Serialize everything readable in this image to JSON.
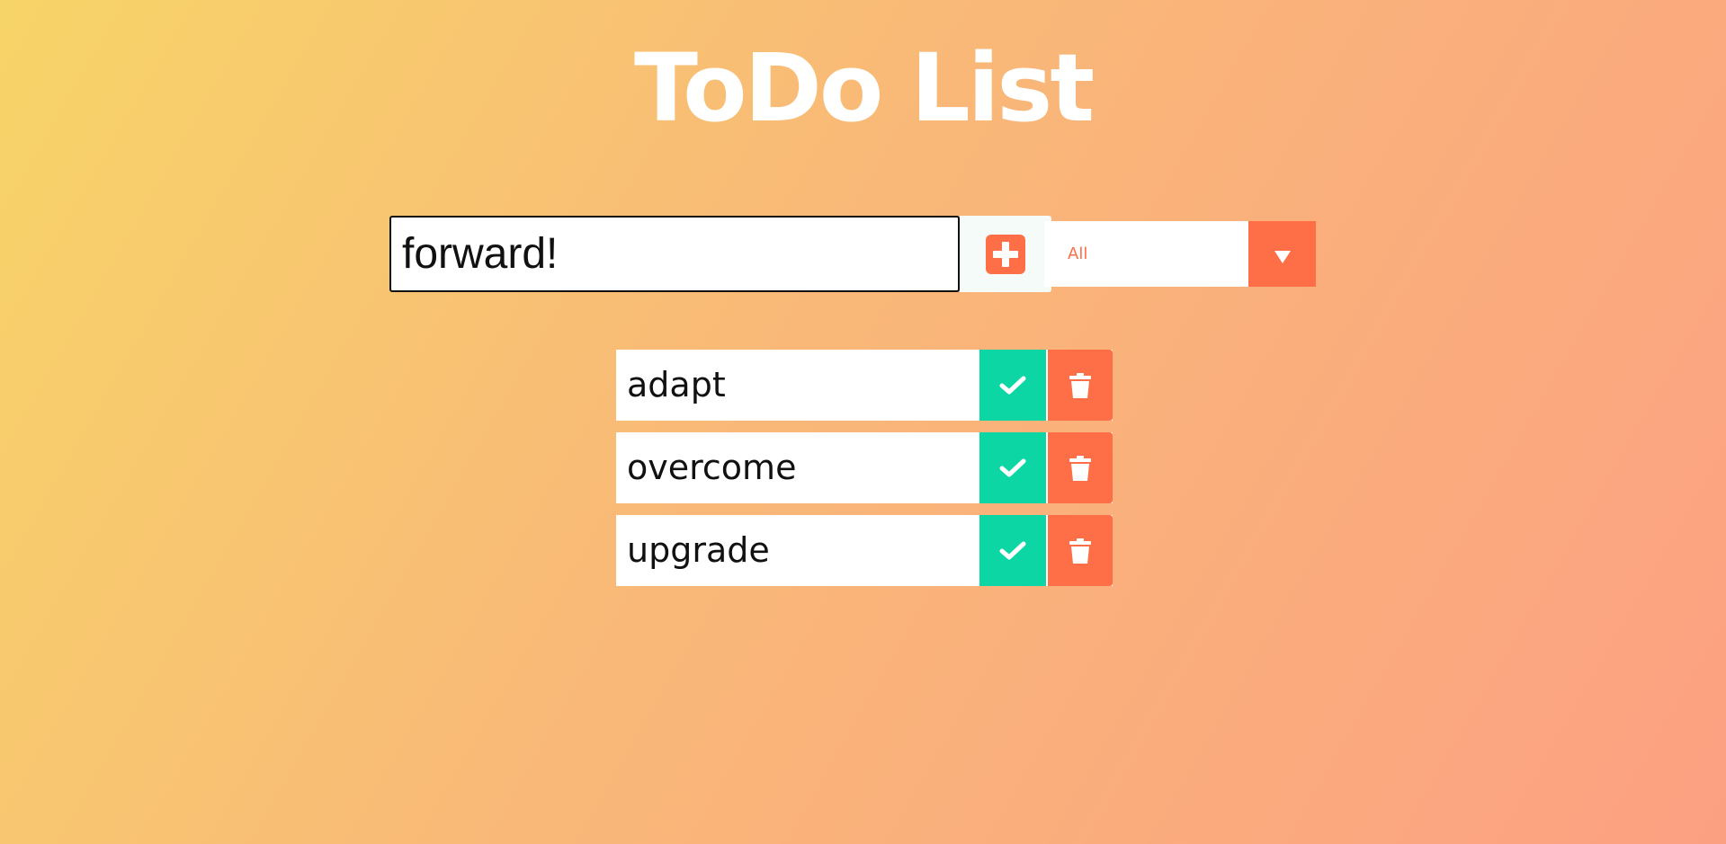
{
  "header": {
    "title": "ToDo List"
  },
  "form": {
    "input_value": "forward!",
    "add_icon": "plus-square-icon",
    "filter": {
      "selected": "All",
      "arrow_icon": "caret-down-icon"
    }
  },
  "todos": [
    {
      "text": "adapt",
      "complete_icon": "check-icon",
      "delete_icon": "trash-icon"
    },
    {
      "text": "overcome",
      "complete_icon": "check-icon",
      "delete_icon": "trash-icon"
    },
    {
      "text": "upgrade",
      "complete_icon": "check-icon",
      "delete_icon": "trash-icon"
    }
  ],
  "colors": {
    "accent": "#ff6f47",
    "complete": "#0dd6a5",
    "gradient_start": "#f7d468",
    "gradient_end": "#fca082",
    "title": "#ffffff"
  }
}
